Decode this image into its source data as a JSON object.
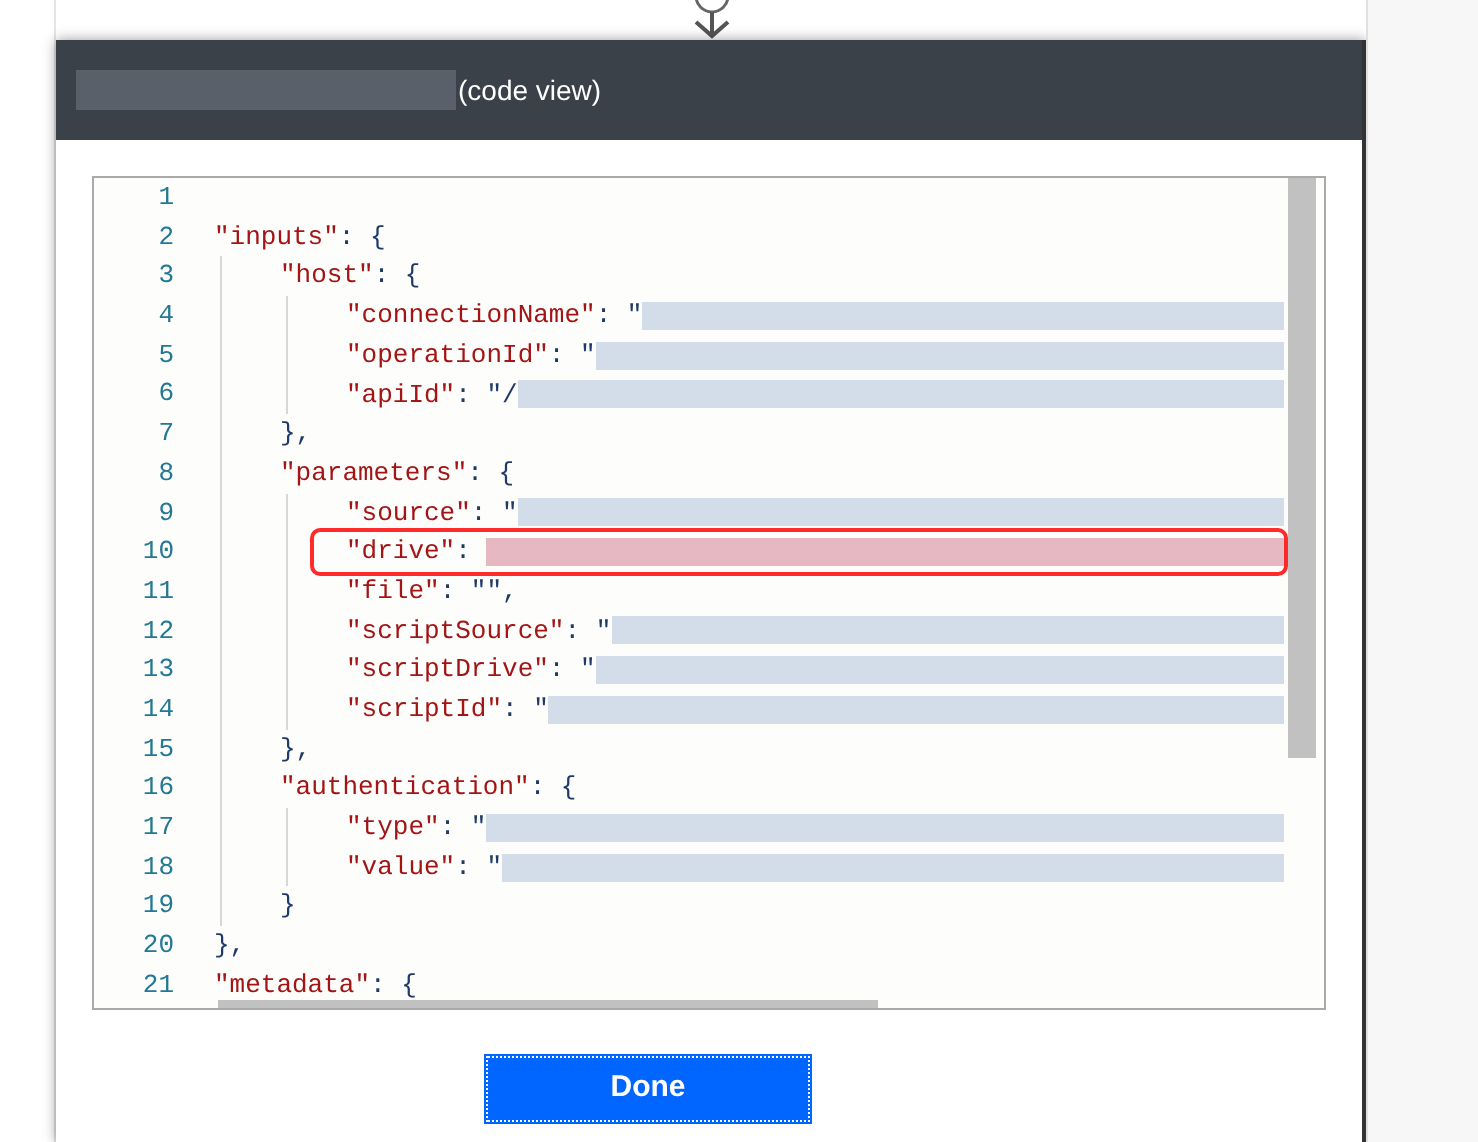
{
  "dialog": {
    "title": "(code view)"
  },
  "code_lines": [
    {
      "number": "1"
    },
    {
      "number": "2",
      "key": "\"inputs\"",
      "rest": ": {",
      "children": [
        {
          "number": "3",
          "key": "\"host\"",
          "rest": ": {",
          "children": [
            {
              "number": "4",
              "key": "\"connectionName\"",
              "rest": ": \"",
              "redacted": true
            },
            {
              "number": "5",
              "key": "\"operationId\"",
              "rest": ": \"",
              "redacted": true
            },
            {
              "number": "6",
              "key": "\"apiId\"",
              "rest": ": \"/",
              "redacted": true
            }
          ]
        },
        {
          "number": "7",
          "rest": "},"
        },
        {
          "number": "8",
          "key": "\"parameters\"",
          "rest": ": {",
          "children": [
            {
              "number": "9",
              "key": "\"source\"",
              "rest": ": \"",
              "redacted": true
            },
            {
              "number": "10",
              "key": "\"drive\"",
              "rest": ": ",
              "redacted": true,
              "highlighted": true
            },
            {
              "number": "11",
              "key": "\"file\"",
              "rest": ": \"\","
            },
            {
              "number": "12",
              "key": "\"scriptSource\"",
              "rest": ": \"",
              "redacted": true
            },
            {
              "number": "13",
              "key": "\"scriptDrive\"",
              "rest": ": \"",
              "redacted": true
            },
            {
              "number": "14",
              "key": "\"scriptId\"",
              "rest": ": \"",
              "redacted": true
            }
          ]
        },
        {
          "number": "15",
          "rest": "},"
        },
        {
          "number": "16",
          "key": "\"authentication\"",
          "rest": ": {",
          "children": [
            {
              "number": "17",
              "key": "\"type\"",
              "rest": ": \"",
              "redacted": true
            },
            {
              "number": "18",
              "key": "\"value\"",
              "rest": ": \"",
              "redacted": true
            }
          ]
        },
        {
          "number": "19",
          "rest": "}"
        }
      ]
    },
    {
      "number": "20",
      "rest": "},"
    },
    {
      "number": "21",
      "key": "\"metadata\"",
      "rest": ": {"
    }
  ],
  "done_button": "Done"
}
